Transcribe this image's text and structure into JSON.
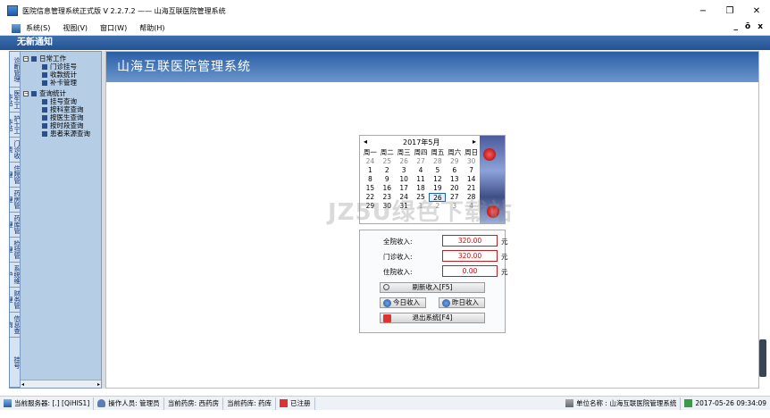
{
  "window": {
    "title": "医院信息管理系统正式版 V 2.2.7.2 —— 山海互联医院管理系统",
    "minimize": "−",
    "restore": "❐",
    "close": "✕"
  },
  "menu": {
    "items": [
      "系统(S)",
      "视图(V)",
      "窗口(W)",
      "帮助(H)"
    ],
    "mdi_controls": [
      "_",
      "ō",
      "x"
    ]
  },
  "notice": "无新通知",
  "vtabs": [
    "挂号",
    "诊断管理",
    "医生工作站",
    "护士工作站",
    "门诊收费",
    "住院管理",
    "药房管理",
    "药库管理",
    "检验管理",
    "系统维护",
    "财务管理",
    "信息查询"
  ],
  "tree": {
    "group1": "日常工作",
    "group1_items": [
      "门诊挂号",
      "收款统计",
      "补卡管理"
    ],
    "group2": "查询统计",
    "group2_items": [
      "挂号查询",
      "按科室查询",
      "按医生查询",
      "按时段查询",
      "患者来源查询"
    ]
  },
  "banner": "山海互联医院管理系统",
  "calendar": {
    "month_label": "2017年5月",
    "prev": "◂",
    "next": "▸",
    "weekdays": [
      "周一",
      "周二",
      "周三",
      "周四",
      "周五",
      "周六",
      "周日"
    ],
    "weeks": [
      [
        "24",
        "25",
        "26",
        "27",
        "28",
        "29",
        "30"
      ],
      [
        "1",
        "2",
        "3",
        "4",
        "5",
        "6",
        "7"
      ],
      [
        "8",
        "9",
        "10",
        "11",
        "12",
        "13",
        "14"
      ],
      [
        "15",
        "16",
        "17",
        "18",
        "19",
        "20",
        "21"
      ],
      [
        "22",
        "23",
        "24",
        "25",
        "26",
        "27",
        "28"
      ],
      [
        "29",
        "30",
        "31",
        "1",
        "2",
        "3",
        "4"
      ]
    ],
    "selected": "26"
  },
  "income": {
    "total_label": "全院收入:",
    "total_value": "320.00",
    "outpatient_label": "门诊收入:",
    "outpatient_value": "320.00",
    "inpatient_label": "住院收入:",
    "inpatient_value": "0.00",
    "unit": "元"
  },
  "buttons": {
    "refresh": "刷新收入[F5]",
    "today": "今日收入",
    "yesterday": "昨日收入",
    "exit": "退出系统[F4]"
  },
  "status": {
    "server": "当前服务器: [.]  [QiHIS1]",
    "operator": "操作人员: 管理员",
    "pharmacy_label": "当前药房:",
    "pharmacy": "西药房",
    "store_label": "当前药库:",
    "store": "药库",
    "registered": "已注册",
    "unit": "单位名称 : 山海互联医院管理系统",
    "datetime": "2017-05-26 09:34:09"
  },
  "watermark": "JZ5U绿色下载站",
  "colors": {
    "accent": "#24528f",
    "value_red": "#e00000"
  }
}
